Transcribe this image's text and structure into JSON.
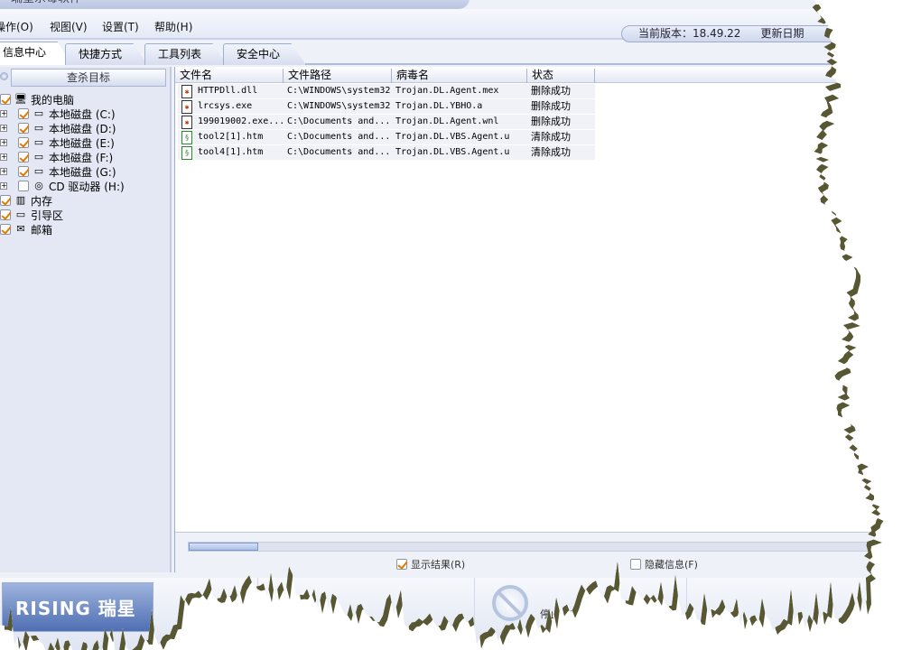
{
  "window": {
    "title": "瑞星杀毒软件"
  },
  "menu": [
    {
      "label": "操作(O)"
    },
    {
      "label": "视图(V)"
    },
    {
      "label": "设置(T)"
    },
    {
      "label": "帮助(H)"
    }
  ],
  "version": {
    "current": "当前版本：18.49.22",
    "update": "更新日期"
  },
  "tabs": [
    {
      "label": "信息中心"
    },
    {
      "label": "快捷方式"
    },
    {
      "label": "工具列表"
    },
    {
      "label": "安全中心"
    }
  ],
  "left": {
    "header": "查杀目标",
    "tree": [
      {
        "label": "我的电脑",
        "icon": "computer-icon",
        "checked": true,
        "level": 0,
        "expander": false
      },
      {
        "label": "本地磁盘 (C:)",
        "icon": "drive-icon",
        "checked": true,
        "level": 1,
        "expander": true
      },
      {
        "label": "本地磁盘 (D:)",
        "icon": "drive-icon",
        "checked": true,
        "level": 1,
        "expander": true
      },
      {
        "label": "本地磁盘 (E:)",
        "icon": "drive-icon",
        "checked": true,
        "level": 1,
        "expander": true
      },
      {
        "label": "本地磁盘 (F:)",
        "icon": "drive-icon",
        "checked": true,
        "level": 1,
        "expander": true
      },
      {
        "label": "本地磁盘 (G:)",
        "icon": "drive-icon",
        "checked": true,
        "level": 1,
        "expander": true
      },
      {
        "label": "CD 驱动器 (H:)",
        "icon": "cd-drive-icon",
        "checked": false,
        "level": 1,
        "expander": true
      },
      {
        "label": "内存",
        "icon": "memory-icon",
        "checked": true,
        "level": 0,
        "expander": false
      },
      {
        "label": "引导区",
        "icon": "boot-sector-icon",
        "checked": true,
        "level": 0,
        "expander": false
      },
      {
        "label": "邮箱",
        "icon": "mail-icon",
        "checked": true,
        "level": 0,
        "expander": false
      }
    ]
  },
  "results": {
    "columns": [
      "文件名",
      "文件路径",
      "病毒名",
      "状态"
    ],
    "rows": [
      {
        "file": "HTTPDll.dll",
        "path": "C:\\WINDOWS\\system32",
        "virus": "Trojan.DL.Agent.mex",
        "status": "删除成功",
        "icon": "virus-file-icon"
      },
      {
        "file": "lrcsys.exe",
        "path": "C:\\WINDOWS\\system32",
        "virus": "Trojan.DL.YBHO.a",
        "status": "删除成功",
        "icon": "virus-file-icon"
      },
      {
        "file": "199019002.exe...",
        "path": "C:\\Documents and...",
        "virus": "Trojan.DL.Agent.wnl",
        "status": "删除成功",
        "icon": "virus-file-icon"
      },
      {
        "file": "tool2[1].htm",
        "path": "C:\\Documents and...",
        "virus": "Trojan.DL.VBS.Agent.u",
        "status": "清除成功",
        "icon": "htm-file-icon"
      },
      {
        "file": "tool4[1].htm",
        "path": "C:\\Documents and...",
        "virus": "Trojan.DL.VBS.Agent.u",
        "status": "清除成功",
        "icon": "htm-file-icon"
      }
    ],
    "show_results": {
      "label": "显示结果(R)",
      "checked": true
    },
    "hide_info": {
      "label": "隐藏信息(F)",
      "checked": false
    }
  },
  "bottom": {
    "logo": "RISING 瑞星",
    "stop": "停止(S)"
  },
  "colors": {
    "accent": "#e07b00",
    "border": "#9eadcf",
    "shadow": "#3a3a10"
  }
}
